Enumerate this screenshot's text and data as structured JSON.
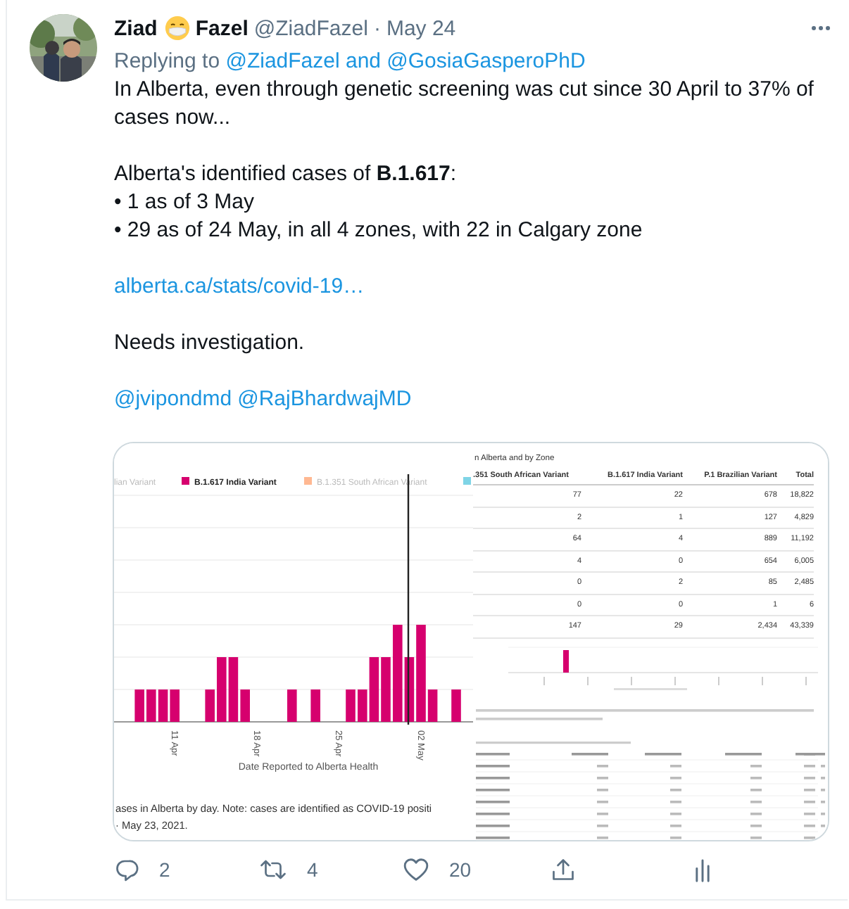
{
  "tweet": {
    "author": {
      "name": "Ziad",
      "name_suffix": "Fazel",
      "handle": "@ZiadFazel",
      "separator": "·",
      "date": "May 24"
    },
    "reply": {
      "prefix": "Replying to",
      "target": "@ZiadFazel and @GosiaGasperoPhD"
    },
    "body": [
      {
        "kind": "text",
        "lines": [
          "In Alberta, even through genetic screening was cut since 30 April to 37% of cases now..."
        ]
      },
      {
        "kind": "text",
        "lines": [
          "Alberta's identified cases of **B.1.617**:",
          "• 1 as of 3 May",
          "• 29 as of 24 May, in all 4 zones, with 22 in Calgary zone"
        ]
      },
      {
        "kind": "link",
        "text": "alberta.ca/stats/covid-19…"
      },
      {
        "kind": "text",
        "lines": [
          "Needs investigation."
        ]
      },
      {
        "kind": "mentions",
        "items": [
          "@jvipondmd",
          "@RajBhardwajMD"
        ]
      }
    ],
    "media": {
      "chart": {
        "legend": [
          {
            "label": "lian Variant",
            "active": false
          },
          {
            "label": "B.1.617 India Variant",
            "color": "#d6006e",
            "active": true
          },
          {
            "label": "B.1.351 South African Variant",
            "color": "#ffb892",
            "active": false
          },
          {
            "color": "#7fd4e6"
          }
        ],
        "x_ticks": [
          "11 Apr",
          "18 Apr",
          "25 Apr",
          "02 May"
        ],
        "x_title": "Date Reported to Alberta Health",
        "caption": [
          "ases in Alberta by day. Note: cases are identified as COVID-19 positi",
          "· May 23, 2021."
        ]
      },
      "table": {
        "title": "n Alberta and by Zone",
        "columns": [
          ".351 South African Variant",
          "B.1.617 India Variant",
          "P.1 Brazilian Variant",
          "Total"
        ],
        "rows": [
          [
            "77",
            "22",
            "678",
            "18,822"
          ],
          [
            "2",
            "1",
            "127",
            "4,829"
          ],
          [
            "64",
            "4",
            "889",
            "11,192"
          ],
          [
            "4",
            "0",
            "654",
            "6,005"
          ],
          [
            "0",
            "2",
            "85",
            "2,485"
          ],
          [
            "0",
            "0",
            "1",
            "6"
          ],
          [
            "147",
            "29",
            "2,434",
            "43,339"
          ]
        ]
      }
    },
    "actions": [
      {
        "kind": "reply",
        "count": "2"
      },
      {
        "kind": "retweet",
        "count": "4"
      },
      {
        "kind": "like",
        "count": "20"
      },
      {
        "kind": "share"
      },
      {
        "kind": "analytics"
      }
    ]
  }
}
